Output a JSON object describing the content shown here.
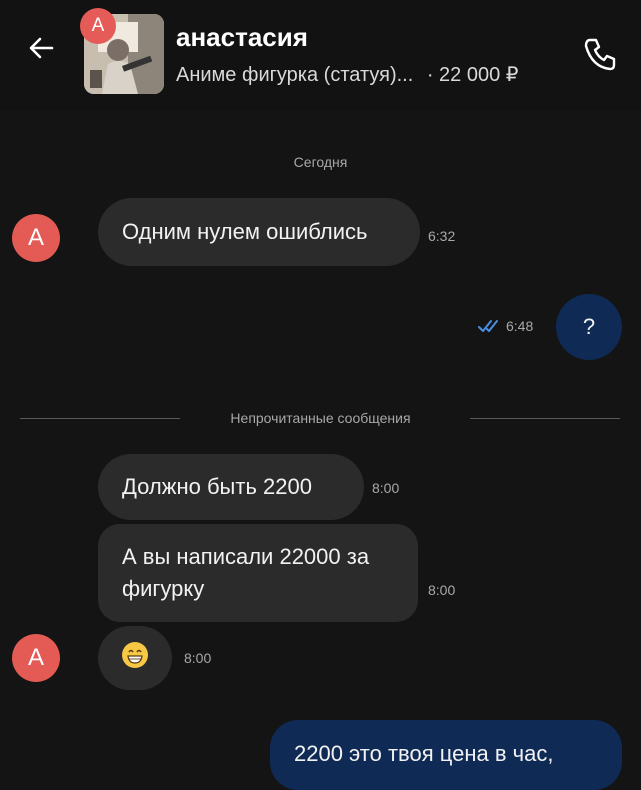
{
  "header": {
    "badge_letter": "А",
    "contact_name": "анастасия",
    "listing_title": "Аниме фигурка (статуя)...",
    "price": "· 22 000 ₽"
  },
  "chat": {
    "date_separator": "Сегодня",
    "unread_separator": "Непрочитанные сообщения",
    "avatar_letter": "А",
    "messages": [
      {
        "text": "Одним нулем ошиблись",
        "time": "6:32"
      },
      {
        "text": "?",
        "time": "6:48"
      },
      {
        "text": "Должно быть 2200",
        "time": "8:00"
      },
      {
        "text": "А вы написали 22000 за фигурку",
        "time": "8:00"
      },
      {
        "text": "😁",
        "time": "8:00"
      },
      {
        "text": "2200 это твоя цена в час,",
        "time": ""
      }
    ]
  },
  "colors": {
    "background": "#141414",
    "incoming_bubble": "#2b2b2b",
    "outgoing_bubble": "#0f2a55",
    "avatar": "#e45b56",
    "read_check": "#4a90e2"
  }
}
